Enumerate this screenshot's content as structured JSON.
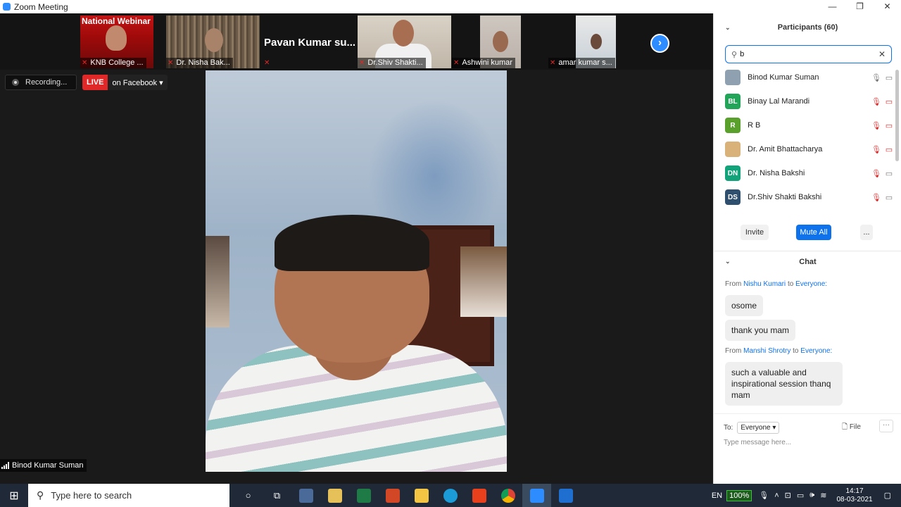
{
  "window": {
    "title": "Zoom Meeting",
    "controls": [
      "—",
      "❐",
      "✕"
    ]
  },
  "gallery": {
    "tiles": [
      {
        "name": "KNB College ...",
        "banner": "National Webinar"
      },
      {
        "name": "Dr. Nisha Bak..."
      },
      {
        "name": "Pavan Kumar su..."
      },
      {
        "name": "Dr.Shiv Shakti..."
      },
      {
        "name": "Ashwini kumar"
      },
      {
        "name": "amar kumar s..."
      }
    ],
    "next_icon": "chevron-right-icon"
  },
  "recording": {
    "label": "Recording..."
  },
  "live": {
    "tag": "LIVE",
    "destination": "on Facebook"
  },
  "speaker": {
    "name": "Binod Kumar Suman"
  },
  "participants": {
    "title": "Participants (60)",
    "search_value": "b",
    "list": [
      {
        "initials": "",
        "name": "Binod Kumar Suman",
        "color": "#8fa0b0",
        "mic": "on",
        "video": "on"
      },
      {
        "initials": "BL",
        "name": "Binay Lal Marandi",
        "color": "#23a559",
        "mic": "off",
        "video": "off"
      },
      {
        "initials": "R",
        "name": "R B",
        "color": "#5aa02c",
        "mic": "off",
        "video": "off"
      },
      {
        "initials": "",
        "name": "Dr. Amit Bhattacharya",
        "color": "#d9b27a",
        "mic": "off",
        "video": "off"
      },
      {
        "initials": "DN",
        "name": "Dr. Nisha Bakshi",
        "color": "#12a37a",
        "mic": "off",
        "video": "on"
      },
      {
        "initials": "DS",
        "name": "Dr.Shiv Shakti Bakshi",
        "color": "#2f4f6f",
        "mic": "off",
        "video": "on"
      }
    ],
    "buttons": {
      "invite": "Invite",
      "mute_all": "Mute All",
      "more": "..."
    }
  },
  "chat": {
    "title": "Chat",
    "messages": [
      {
        "from_label": "From",
        "sender": "Nishu Kumari",
        "to_label": "to",
        "recipient": "Everyone:",
        "bubbles": [
          "osome",
          "thank you mam"
        ]
      },
      {
        "from_label": "From",
        "sender": "Manshi Shrotry",
        "to_label": "to",
        "recipient": "Everyone:",
        "bubbles": [
          "such a valuable and inspirational session thanq mam"
        ]
      }
    ],
    "to_label": "To:",
    "to_value": "Everyone",
    "file_label": "File",
    "more": "···",
    "placeholder": "Type message here..."
  },
  "taskbar": {
    "search_placeholder": "Type here to search",
    "lang": "EN",
    "battery": "100%",
    "time": "14:17",
    "date": "08-03-2021"
  },
  "colors": {
    "accent": "#0e72ed",
    "live_red": "#e02828",
    "muted_red": "#e02828"
  }
}
